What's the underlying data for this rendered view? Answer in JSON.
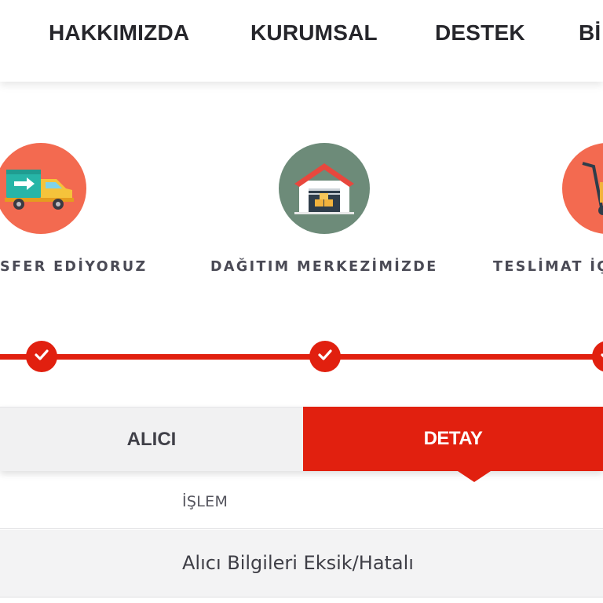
{
  "nav": {
    "items": [
      "HAKKIMIZDA",
      "KURUMSAL",
      "DESTEK",
      "Bİ"
    ]
  },
  "steps": [
    {
      "label": "SFER EDİYORUZ",
      "icon": "delivery-truck-icon",
      "color": "#f36a50",
      "completed": true
    },
    {
      "label": "DAĞITIM MERKEZİMİZDE",
      "icon": "warehouse-icon",
      "color": "#6d8b79",
      "completed": true
    },
    {
      "label": "TESLİMAT İÇ",
      "icon": "hand-truck-icon",
      "color": "#f36a50",
      "completed": true
    }
  ],
  "tabs": {
    "alici": "ALICI",
    "detay": "DETAY",
    "active": "detay"
  },
  "table": {
    "columns": [
      "İŞLEM"
    ],
    "rows": [
      [
        "Alıcı Bilgileri Eksik/Hatalı"
      ]
    ]
  },
  "colors": {
    "accent": "#e1200f",
    "coral": "#f36a50",
    "sage": "#6d8b79"
  }
}
